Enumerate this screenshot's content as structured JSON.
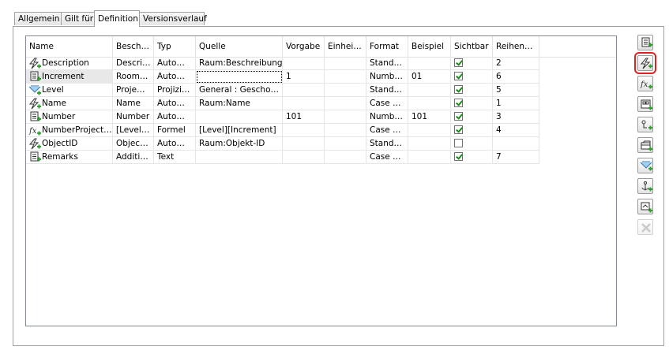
{
  "tabs": [
    {
      "label": "Allgemein"
    },
    {
      "label": "Gilt für"
    },
    {
      "label": "Definition"
    },
    {
      "label": "Versionsverlauf"
    }
  ],
  "columns": [
    "Name",
    "Besch…",
    "Typ",
    "Quelle",
    "Vorgabe",
    "Einhei…",
    "Format",
    "Beispiel",
    "Sichtbar",
    "Reihen…"
  ],
  "rows": [
    {
      "icon": "lightning-add-icon",
      "name": "Description",
      "beschreibung": "Descri…",
      "typ": "Auto…",
      "quelle": "Raum:Beschreibung",
      "vorgabe": "",
      "einheit": "",
      "format": "Stand…",
      "beispiel": "",
      "sichtbar": true,
      "reihenfolge": "2"
    },
    {
      "icon": "table-add-icon",
      "name": "Increment",
      "beschreibung": "Room…",
      "typ": "Auto…",
      "quelle": "",
      "vorgabe": "1",
      "einheit": "",
      "format": "Numb…",
      "beispiel": "01",
      "sichtbar": true,
      "reihenfolge": "6"
    },
    {
      "icon": "level-icon",
      "name": "Level",
      "beschreibung": "Proje…",
      "typ": "Projizi…",
      "quelle": "General : Gescho…",
      "vorgabe": "",
      "einheit": "",
      "format": "Stand…",
      "beispiel": "",
      "sichtbar": true,
      "reihenfolge": "5"
    },
    {
      "icon": "lightning-add-icon",
      "name": "Name",
      "beschreibung": "Name",
      "typ": "Auto…",
      "quelle": "Raum:Name",
      "vorgabe": "",
      "einheit": "",
      "format": "Case …",
      "beispiel": "",
      "sichtbar": true,
      "reihenfolge": "1"
    },
    {
      "icon": "table-add-icon",
      "name": "Number",
      "beschreibung": "Number",
      "typ": "Auto…",
      "quelle": "",
      "vorgabe": "101",
      "einheit": "",
      "format": "Numb…",
      "beispiel": "101",
      "sichtbar": true,
      "reihenfolge": "3"
    },
    {
      "icon": "formula-add-icon",
      "name": "NumberProject…",
      "beschreibung": "[Level…",
      "typ": "Formel",
      "quelle": "[Level][Increment]",
      "vorgabe": "",
      "einheit": "",
      "format": "Case …",
      "beispiel": "",
      "sichtbar": true,
      "reihenfolge": "4"
    },
    {
      "icon": "lightning-add-icon",
      "name": "ObjectID",
      "beschreibung": "Objec…",
      "typ": "Auto…",
      "quelle": "Raum:Objekt-ID",
      "vorgabe": "",
      "einheit": "",
      "format": "Stand…",
      "beispiel": "",
      "sichtbar": false,
      "reihenfolge": ""
    },
    {
      "icon": "table-add-icon",
      "name": "Remarks",
      "beschreibung": "Additi…",
      "typ": "Text",
      "quelle": "",
      "vorgabe": "",
      "einheit": "",
      "format": "Case …",
      "beispiel": "",
      "sichtbar": true,
      "reihenfolge": "7"
    }
  ],
  "toolbar": [
    {
      "name": "add-text-property-button",
      "icon": "table-add-icon"
    },
    {
      "name": "add-automatic-property-button",
      "icon": "lightning-add-icon",
      "highlighted": true
    },
    {
      "name": "add-formula-property-button",
      "icon": "formula-add-icon"
    },
    {
      "name": "add-grid-property-button",
      "icon": "grid-add-icon"
    },
    {
      "name": "add-link-property-button",
      "icon": "link-add-icon"
    },
    {
      "name": "add-object-property-button",
      "icon": "box-add-icon"
    },
    {
      "name": "add-level-property-button",
      "icon": "level-icon"
    },
    {
      "name": "add-anchor-property-button",
      "icon": "anchor-add-icon"
    },
    {
      "name": "add-view-property-button",
      "icon": "view-add-icon"
    },
    {
      "name": "delete-property-button",
      "icon": "delete-icon",
      "disabled": true
    }
  ],
  "colors": {
    "accent_highlight": "#e02020",
    "add_green": "#2aa52a",
    "border": "#a0a0a0"
  }
}
